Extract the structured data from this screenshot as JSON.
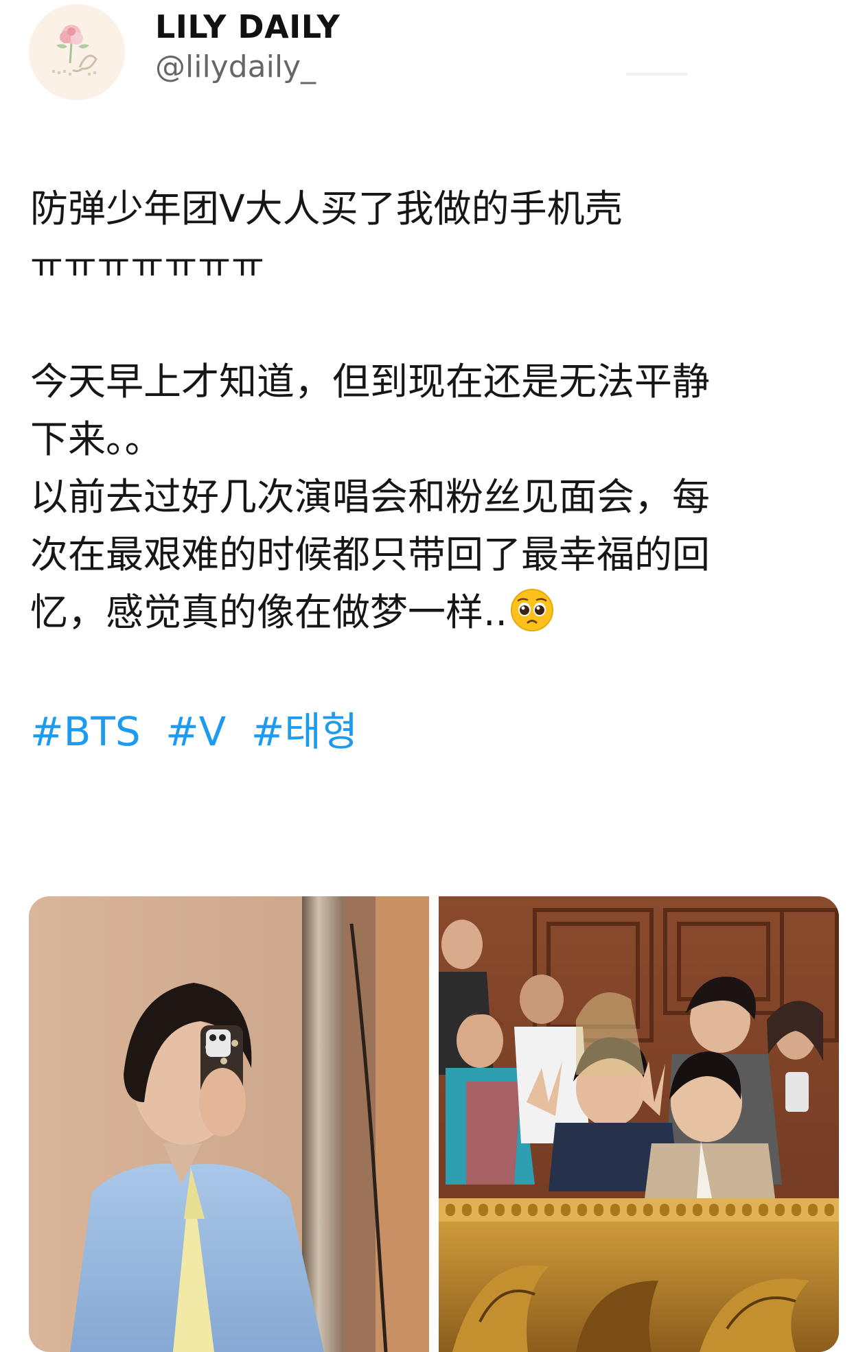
{
  "author": {
    "name": "LILY DAILY",
    "handle": "@lilydaily_",
    "avatar_icon": "rose-embroidery-avatar"
  },
  "tweet": {
    "lines": [
      "防弹少年团V大人买了我做的手机壳",
      "ㅠㅠㅠㅠㅠㅠㅠ",
      "",
      "今天早上才知道，但到现在还是无法平静",
      "下来。。",
      "以前去过好几次演唱会和粉丝见面会，每",
      "次在最艰难的时候都只带回了最幸福的回",
      "忆，感觉真的像在做梦一样.."
    ],
    "trailing_emoji": "pleading-face-emoji",
    "hashtags": [
      "#BTS",
      "#V",
      "#태형"
    ]
  },
  "media": [
    {
      "icon": "mirror-selfie-photo"
    },
    {
      "icon": "group-selfie-photo"
    }
  ],
  "colors": {
    "link": "#1d9bf0",
    "text": "#161616",
    "handle": "#666666"
  }
}
